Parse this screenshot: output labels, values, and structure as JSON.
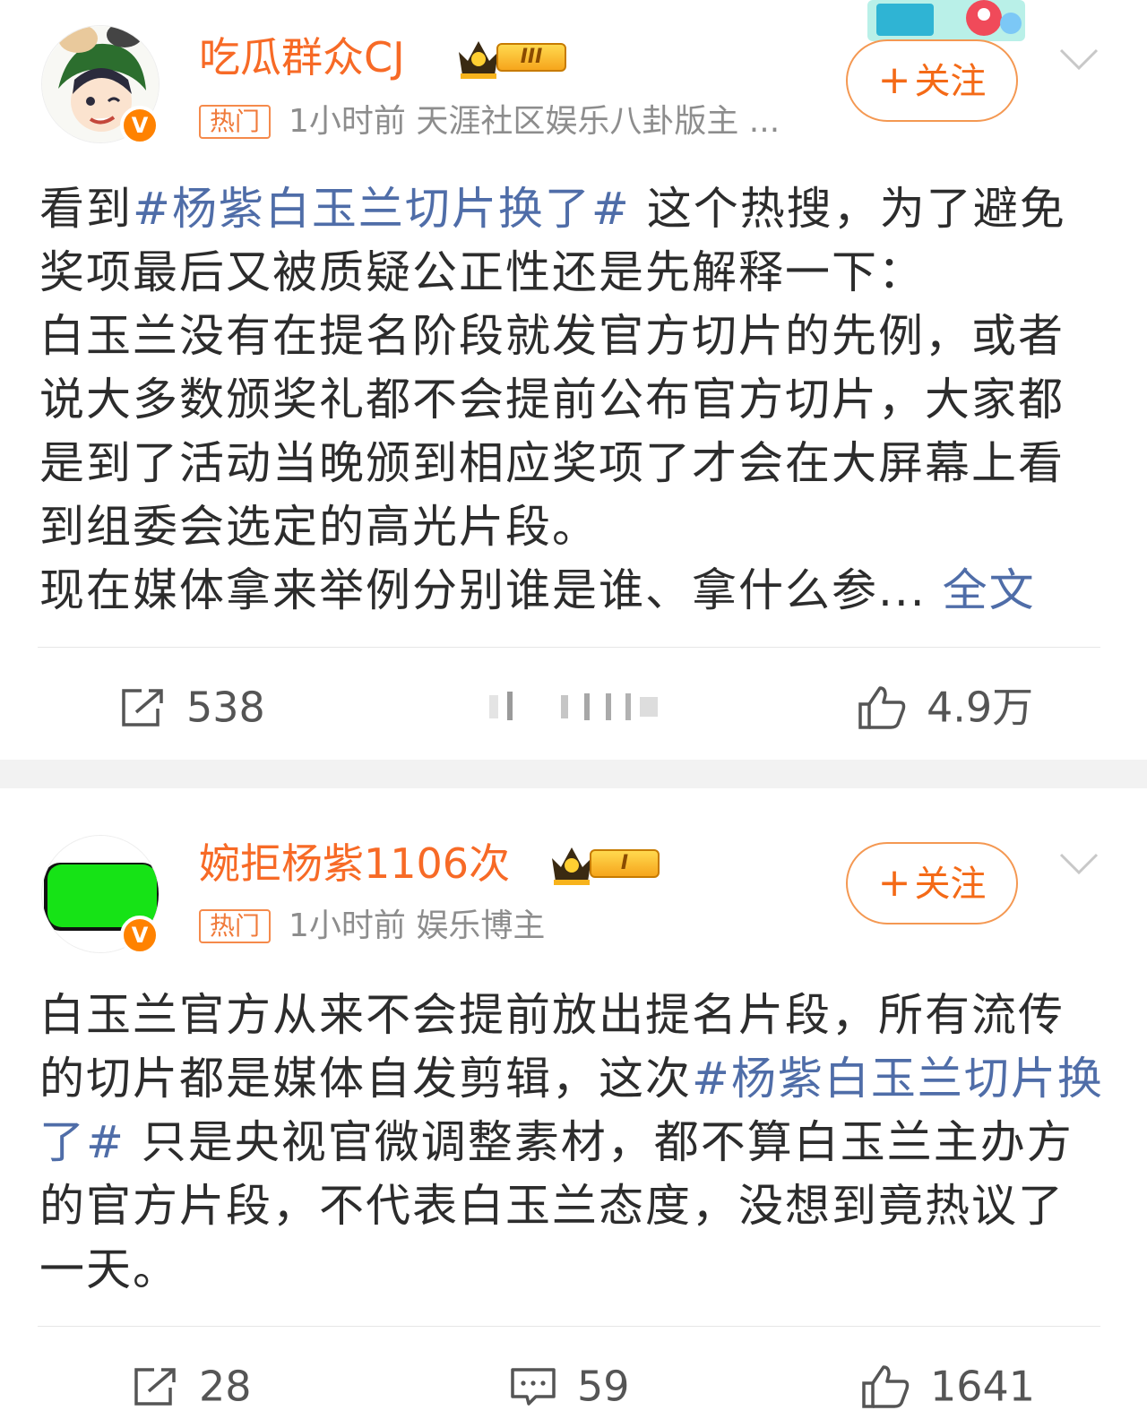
{
  "colors": {
    "accent": "#f76a26",
    "link": "#4f6da8",
    "verified": "#ff8200"
  },
  "posts": [
    {
      "username": "吃瓜群众CJ",
      "level_badge": "III",
      "tag": "热门",
      "meta": "1小时前   天涯社区娱乐八卦版主 ...",
      "follow_label": "关注",
      "follow_plus": "+",
      "content": {
        "before": "看到",
        "hashtag": "#杨紫白玉兰切片换了#",
        "after": " 这个热搜，为了避免奖项最后又被质疑公正性还是先解释一下：\n白玉兰没有在提名阶段就发官方切片的先例，或者说大多数颁奖礼都不会提前公布官方切片，大家都是到了活动当晚颁到相应奖项了才会在大屏幕上看到组委会选定的高光片段。\n现在媒体拿来举例分别谁是谁、拿什么参...",
        "full_text_link": "全文"
      },
      "actions": {
        "repost_icon": "share-icon",
        "repost_count": "538",
        "like_icon": "thumbs-up-icon",
        "like_count": "4.9万"
      }
    },
    {
      "username": "婉拒杨紫1106次",
      "level_badge": "I",
      "tag": "热门",
      "meta": "1小时前   娱乐博主",
      "follow_label": "关注",
      "follow_plus": "+",
      "content": {
        "before": "白玉兰官方从来不会提前放出提名片段，所有流传的切片都是媒体自发剪辑，这次",
        "hashtag": "#杨紫白玉兰切片换了#",
        "after": " 只是央视官微调整素材，都不算白玉兰主办方的官方片段，不代表白玉兰态度，没想到竟热议了一天。"
      },
      "actions": {
        "repost_icon": "share-icon",
        "repost_count": "28",
        "comment_icon": "comment-icon",
        "comment_count": "59",
        "like_icon": "thumbs-up-icon",
        "like_count": "1641"
      }
    }
  ]
}
